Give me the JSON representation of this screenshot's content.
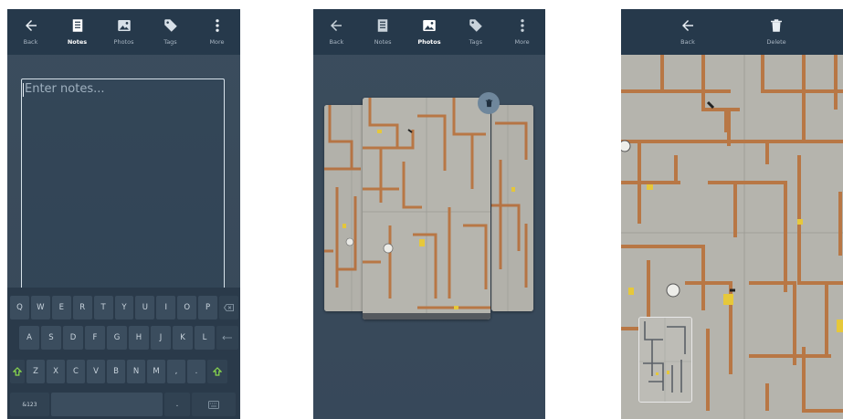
{
  "screen1": {
    "toolbar": [
      {
        "key": "back",
        "label": "Back",
        "icon": "arrow-left-icon"
      },
      {
        "key": "notes",
        "label": "Notes",
        "icon": "notes-icon",
        "active": true
      },
      {
        "key": "photos",
        "label": "Photos",
        "icon": "image-icon"
      },
      {
        "key": "tags",
        "label": "Tags",
        "icon": "tag-icon"
      },
      {
        "key": "more",
        "label": "More",
        "icon": "more-vertical-icon"
      }
    ],
    "notes_placeholder": "Enter notes...",
    "keyboard": {
      "row1": [
        "Q",
        "W",
        "E",
        "R",
        "T",
        "Y",
        "U",
        "I",
        "O",
        "P"
      ],
      "row2": [
        "A",
        "S",
        "D",
        "F",
        "G",
        "H",
        "J",
        "K",
        "L"
      ],
      "row3": [
        "Z",
        "X",
        "C",
        "V",
        "B",
        "N",
        "M",
        ",",
        "."
      ],
      "symbols_key": "&123",
      "period_key": "."
    }
  },
  "screen2": {
    "toolbar": [
      {
        "key": "back",
        "label": "Back",
        "icon": "arrow-left-icon"
      },
      {
        "key": "notes",
        "label": "Notes",
        "icon": "notes-icon"
      },
      {
        "key": "photos",
        "label": "Photos",
        "icon": "image-icon",
        "active": true
      },
      {
        "key": "tags",
        "label": "Tags",
        "icon": "tag-icon"
      },
      {
        "key": "more",
        "label": "More",
        "icon": "more-vertical-icon"
      }
    ]
  },
  "screen3": {
    "toolbar": [
      {
        "key": "back",
        "label": "Back",
        "icon": "arrow-left-icon"
      },
      {
        "key": "delete",
        "label": "Delete",
        "icon": "trash-icon"
      }
    ]
  },
  "colors": {
    "toolbar_bg": "#26394b",
    "screen_bg": "#3b4d5e",
    "keyboard_bg": "#2a3a4a",
    "accent_green": "#8ad94d",
    "photo_wall": "#b5b4ad",
    "copper_pipe": "#b87745"
  }
}
